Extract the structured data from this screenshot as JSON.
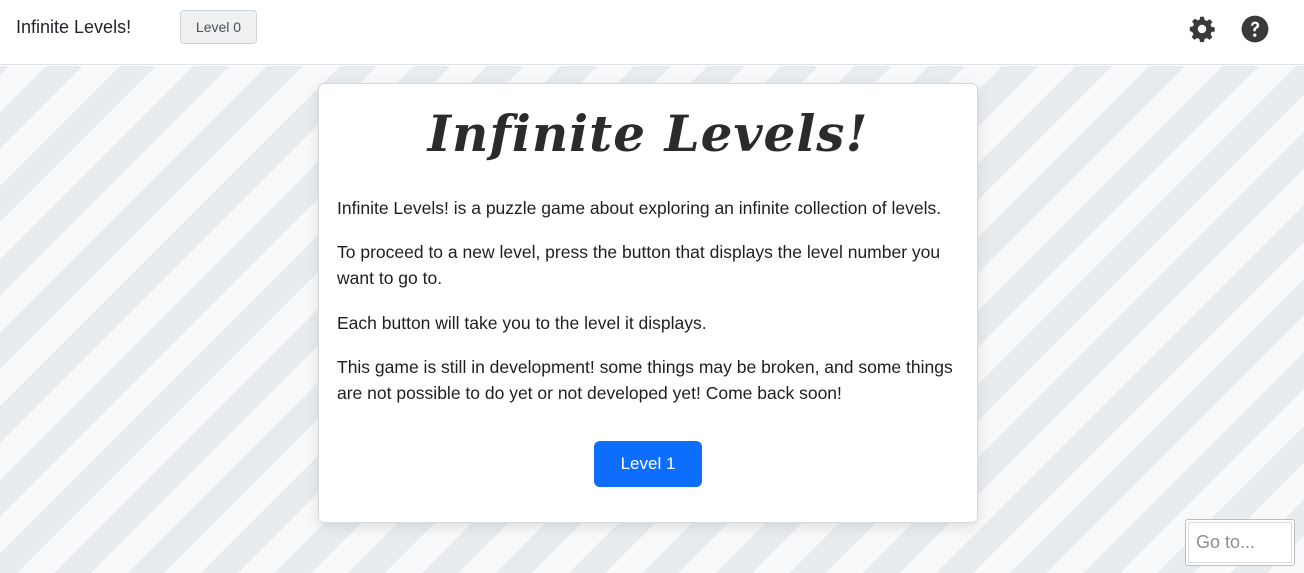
{
  "header": {
    "app_title": "Infinite Levels!",
    "current_level_label": "Level 0",
    "settings_icon": "gear-icon",
    "help_icon": "question-circle-icon"
  },
  "card": {
    "title": "Infinite Levels!",
    "paragraphs": [
      "Infinite Levels! is a puzzle game about exploring an infinite collection of levels.",
      "To proceed to a new level, press the button that displays the level number you want to go to.",
      "Each button will take you to the level it displays.",
      "This game is still in development! some things may be broken, and some things are not possible to do yet or not developed yet! Come back soon!"
    ],
    "next_level_button": "Level 1"
  },
  "goto": {
    "placeholder": "Go to...",
    "value": ""
  },
  "colors": {
    "primary": "#0d6efd",
    "stripe_light": "#f8f9fa",
    "stripe_dark": "#e9ecef",
    "icon": "#3a3a3a"
  }
}
